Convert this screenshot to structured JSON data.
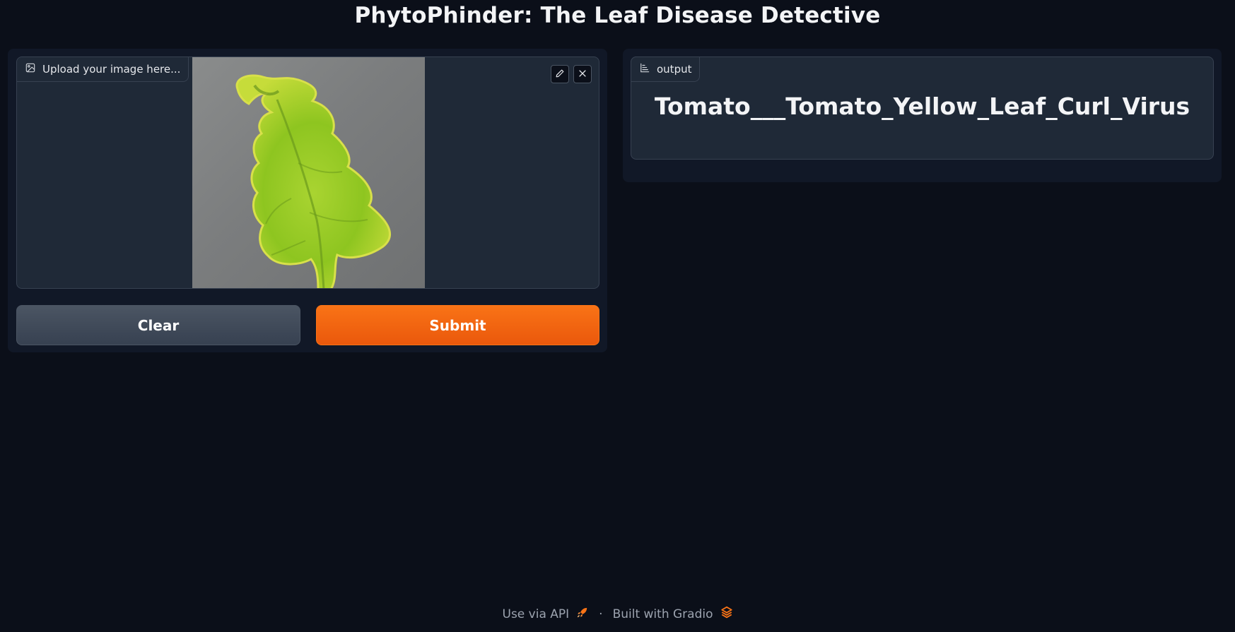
{
  "app": {
    "title": "PhytoPhinder: The Leaf Disease Detective"
  },
  "input": {
    "label": "Upload your image here...",
    "label_icon": "image-icon",
    "edit_icon": "pencil-icon",
    "remove_icon": "close-icon"
  },
  "buttons": {
    "clear_label": "Clear",
    "submit_label": "Submit"
  },
  "output": {
    "label": "output",
    "label_icon": "bar-chart-icon",
    "value": "Tomato___Tomato_Yellow_Leaf_Curl_Virus"
  },
  "footer": {
    "api_label": "Use via API",
    "api_icon": "rocket-icon",
    "separator": "·",
    "built_label": "Built with Gradio",
    "gradio_icon": "gradio-logo-icon"
  },
  "colors": {
    "background": "#0b0f19",
    "panel": "#111827",
    "block": "#1f2937",
    "accent": "#f97316",
    "secondary_button": "#4b5563"
  }
}
